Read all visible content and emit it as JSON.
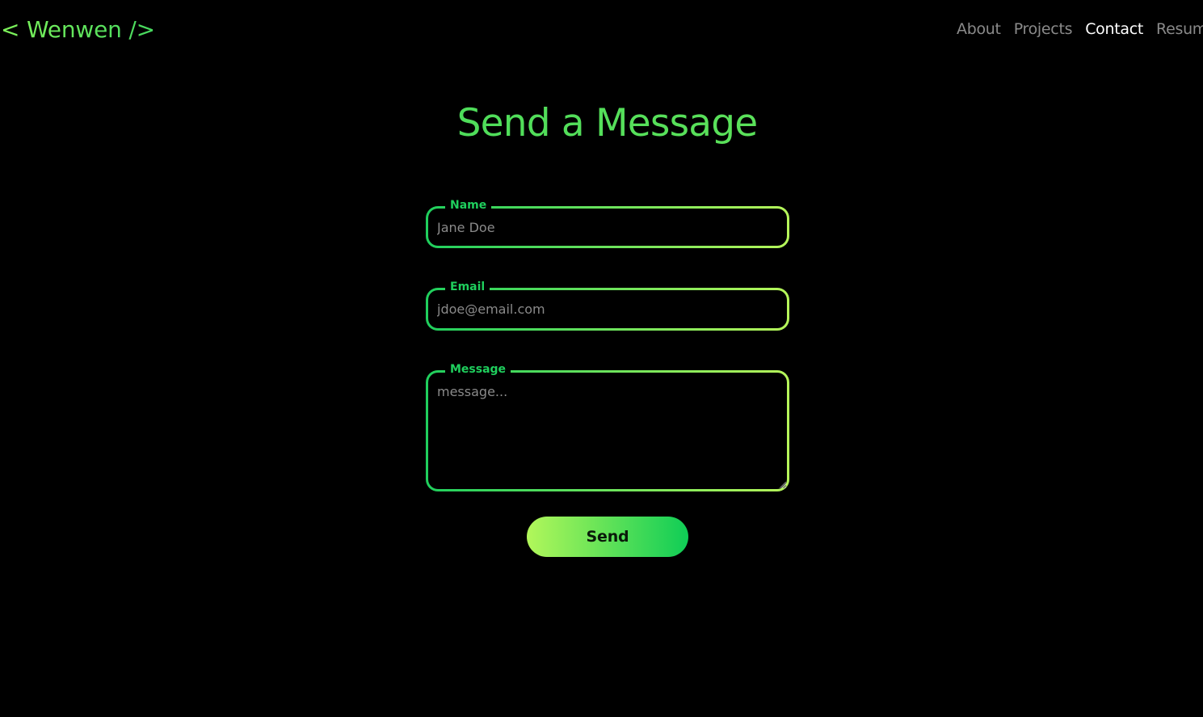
{
  "header": {
    "logo": "< Wenwen />",
    "nav": [
      {
        "label": "About",
        "active": false
      },
      {
        "label": "Projects",
        "active": false
      },
      {
        "label": "Contact",
        "active": true
      },
      {
        "label": "Resume",
        "active": false
      }
    ]
  },
  "main": {
    "title": "Send a Message",
    "form": {
      "name": {
        "label": "Name",
        "placeholder": "Jane Doe",
        "value": ""
      },
      "email": {
        "label": "Email",
        "placeholder": "jdoe@email.com",
        "value": ""
      },
      "message": {
        "label": "Message",
        "placeholder": "message...",
        "value": ""
      },
      "submit_label": "Send"
    }
  },
  "colors": {
    "background": "#000000",
    "accent_green": "#1fcf5d",
    "accent_lime": "#b6f75a",
    "nav_inactive": "#8a8a8a",
    "nav_active": "#ffffff"
  }
}
